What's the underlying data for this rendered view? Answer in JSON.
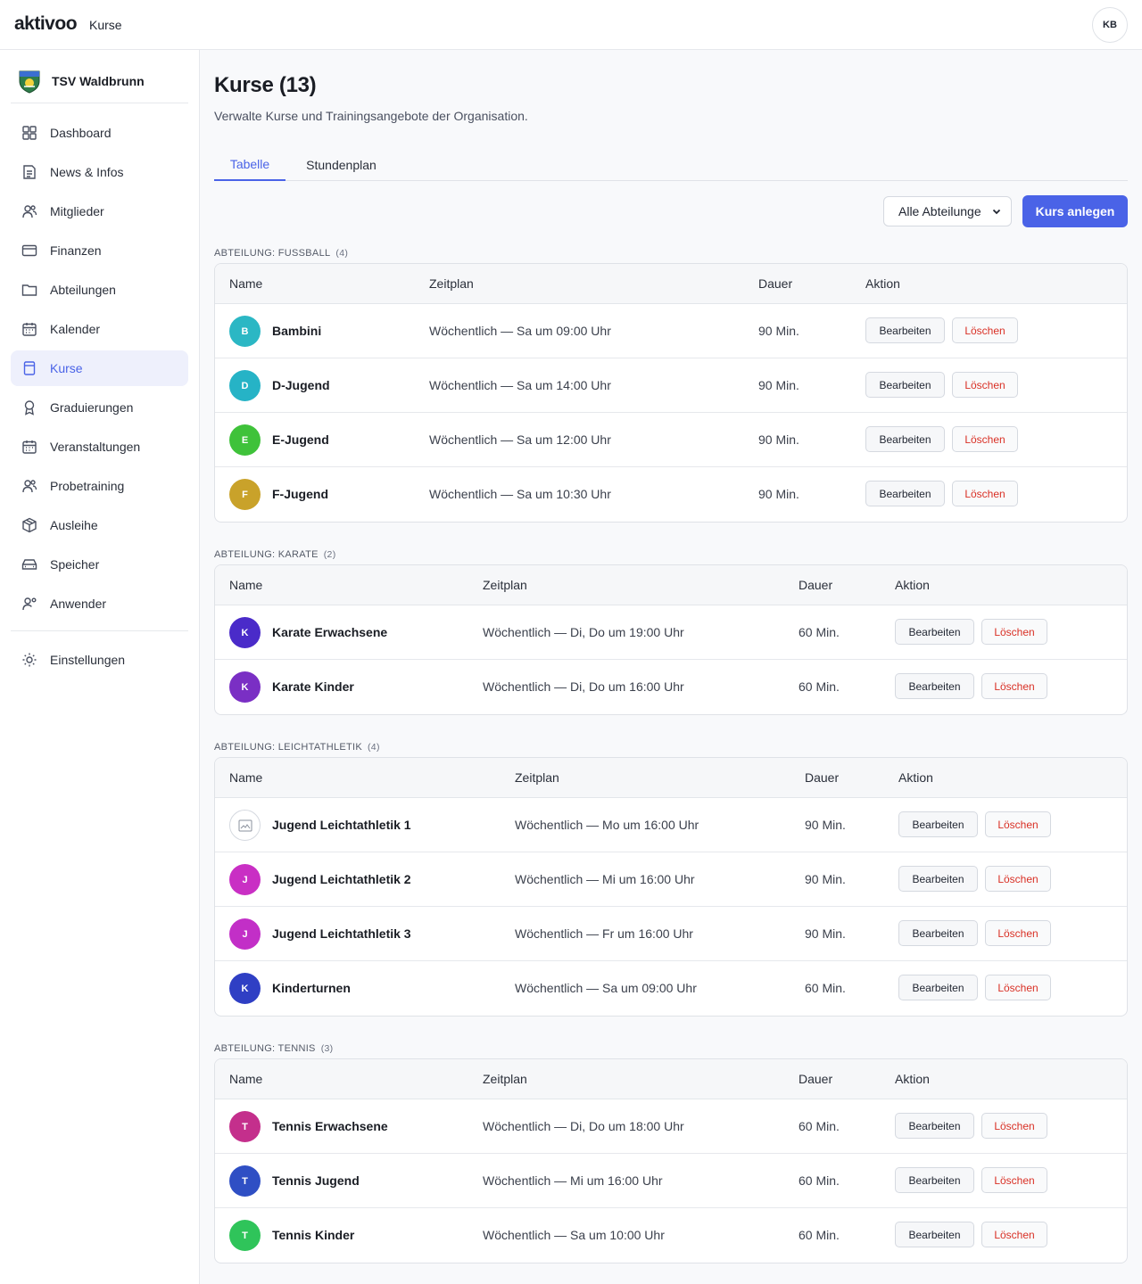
{
  "app": {
    "logo": "aktivoo",
    "section": "Kurse",
    "user_initials": "KB"
  },
  "org": {
    "name": "TSV Waldbrunn"
  },
  "sidebar": {
    "items": [
      {
        "label": "Dashboard",
        "icon": "grid-icon"
      },
      {
        "label": "News & Infos",
        "icon": "news-icon"
      },
      {
        "label": "Mitglieder",
        "icon": "users-icon"
      },
      {
        "label": "Finanzen",
        "icon": "card-icon"
      },
      {
        "label": "Abteilungen",
        "icon": "folder-icon"
      },
      {
        "label": "Kalender",
        "icon": "calendar-icon"
      },
      {
        "label": "Kurse",
        "icon": "book-icon",
        "active": true
      },
      {
        "label": "Graduierungen",
        "icon": "award-icon"
      },
      {
        "label": "Veranstaltungen",
        "icon": "calendar-icon"
      },
      {
        "label": "Probetraining",
        "icon": "users-icon"
      },
      {
        "label": "Ausleihe",
        "icon": "box-icon"
      },
      {
        "label": "Speicher",
        "icon": "storage-icon"
      },
      {
        "label": "Anwender",
        "icon": "user-gear-icon"
      }
    ],
    "settings": {
      "label": "Einstellungen",
      "icon": "sun-gear-icon"
    }
  },
  "main": {
    "title": "Kurse (13)",
    "subtitle": "Verwalte Kurse und Trainingsangebote der Organisation.",
    "tabs": [
      {
        "label": "Tabelle",
        "active": true
      },
      {
        "label": "Stundenplan"
      }
    ],
    "filter": {
      "selected": "Alle Abteilunge"
    },
    "create_button": "Kurs anlegen",
    "columns": {
      "name": "Name",
      "schedule": "Zeitplan",
      "duration": "Dauer",
      "action": "Aktion"
    },
    "edit_label": "Bearbeiten",
    "delete_label": "Löschen",
    "accent": "#4a63e7",
    "delete_color": "#d93025"
  },
  "sections": [
    {
      "label": "ABTEILUNG: FUSSBALL",
      "count": "(4)",
      "rows": [
        {
          "initial": "B",
          "color": "#2bb7c4",
          "name": "Bambini",
          "schedule": "Wöchentlich — Sa um 09:00 Uhr",
          "duration": "90 Min."
        },
        {
          "initial": "D",
          "color": "#26b3c6",
          "name": "D-Jugend",
          "schedule": "Wöchentlich — Sa um 14:00 Uhr",
          "duration": "90 Min."
        },
        {
          "initial": "E",
          "color": "#3fc23a",
          "name": "E-Jugend",
          "schedule": "Wöchentlich — Sa um 12:00 Uhr",
          "duration": "90 Min."
        },
        {
          "initial": "F",
          "color": "#c9a22a",
          "name": "F-Jugend",
          "schedule": "Wöchentlich — Sa um 10:30 Uhr",
          "duration": "90 Min."
        }
      ]
    },
    {
      "label": "ABTEILUNG: KARATE",
      "count": "(2)",
      "rows": [
        {
          "initial": "K",
          "color": "#4a2bc9",
          "name": "Karate Erwachsene",
          "schedule": "Wöchentlich — Di, Do um 19:00 Uhr",
          "duration": "60 Min."
        },
        {
          "initial": "K",
          "color": "#7a2fc4",
          "name": "Karate Kinder",
          "schedule": "Wöchentlich — Di, Do um 16:00 Uhr",
          "duration": "60 Min."
        }
      ]
    },
    {
      "label": "ABTEILUNG: LEICHTATHLETIK",
      "count": "(4)",
      "rows": [
        {
          "initial": "",
          "color": "broken-image",
          "name": "Jugend Leichtathletik 1",
          "schedule": "Wöchentlich — Mo um 16:00 Uhr",
          "duration": "90 Min."
        },
        {
          "initial": "J",
          "color": "#c92fc4",
          "name": "Jugend Leichtathletik 2",
          "schedule": "Wöchentlich — Mi um 16:00 Uhr",
          "duration": "90 Min."
        },
        {
          "initial": "J",
          "color": "#c22fc7",
          "name": "Jugend Leichtathletik 3",
          "schedule": "Wöchentlich — Fr um 16:00 Uhr",
          "duration": "90 Min."
        },
        {
          "initial": "K",
          "color": "#2f3fc4",
          "name": "Kinderturnen",
          "schedule": "Wöchentlich — Sa um 09:00 Uhr",
          "duration": "60 Min."
        }
      ]
    },
    {
      "label": "ABTEILUNG: TENNIS",
      "count": "(3)",
      "rows": [
        {
          "initial": "T",
          "color": "#c42f8c",
          "name": "Tennis Erwachsene",
          "schedule": "Wöchentlich — Di, Do um 18:00 Uhr",
          "duration": "60 Min."
        },
        {
          "initial": "T",
          "color": "#2f4fc4",
          "name": "Tennis Jugend",
          "schedule": "Wöchentlich — Mi um 16:00 Uhr",
          "duration": "60 Min."
        },
        {
          "initial": "T",
          "color": "#2fc45a",
          "name": "Tennis Kinder",
          "schedule": "Wöchentlich — Sa um 10:00 Uhr",
          "duration": "60 Min."
        }
      ]
    }
  ]
}
